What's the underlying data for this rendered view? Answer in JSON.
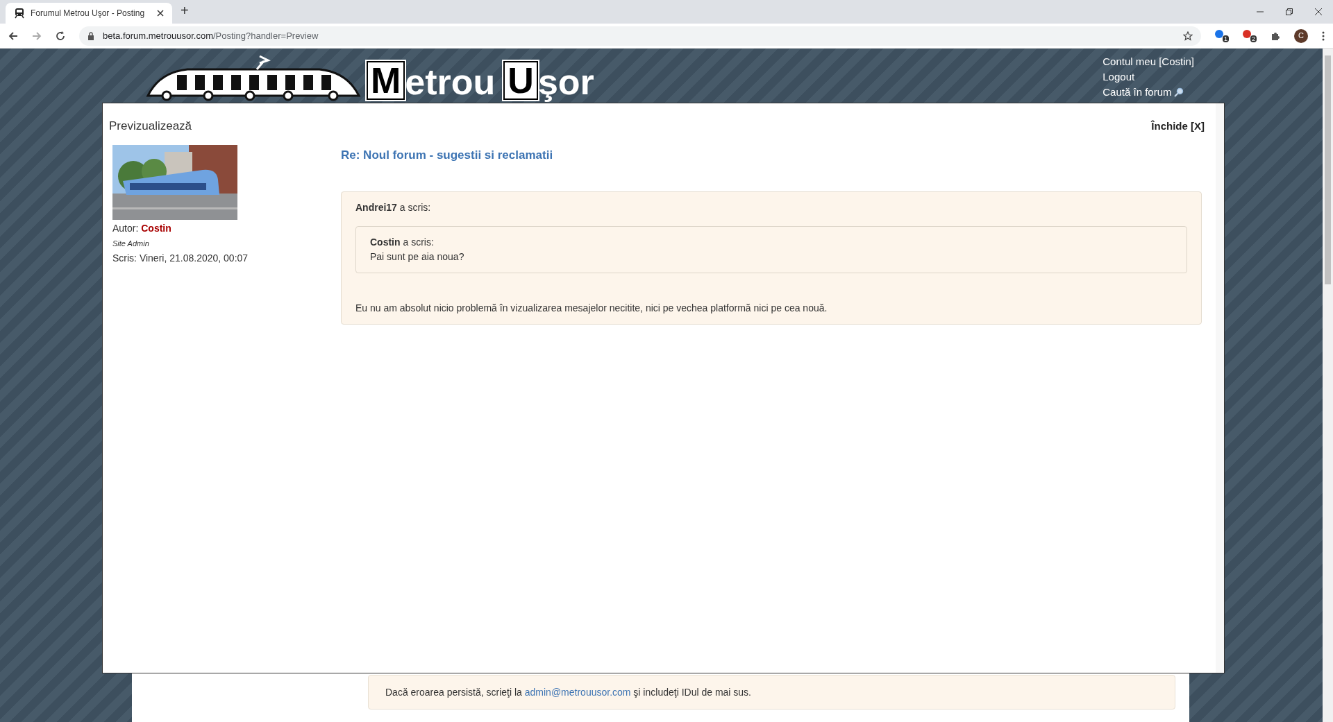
{
  "browser": {
    "tab": {
      "title": "Forumul Metrou Uşor - Posting",
      "selected": true
    },
    "new_tab": "+",
    "url_host": "beta.forum.metrouusor.com",
    "url_path": "/Posting?handler=Preview",
    "extensions": [
      {
        "badge": "1",
        "color": "#1a73e8"
      },
      {
        "badge": "2",
        "color": "#d93025"
      }
    ],
    "profile": "C"
  },
  "header": {
    "logo": [
      {
        "text": "M",
        "kind": "boxed"
      },
      {
        "text": "etrou",
        "kind": "plain"
      },
      {
        "text": "U",
        "kind": "boxed"
      },
      {
        "text": "şor",
        "kind": "plain"
      }
    ],
    "links": [
      {
        "label": "Contul meu [Costin]",
        "kind": "text"
      },
      {
        "label": "Logout",
        "kind": "text"
      },
      {
        "label": "Caută în forum",
        "kind": "search"
      }
    ]
  },
  "preview": {
    "title": "Previzualizează",
    "close": "Închide [X]",
    "author": {
      "label": "Autor:",
      "name": "Costin",
      "role": "Site Admin",
      "date": "Scris: Vineri, 21.08.2020, 00:07"
    },
    "subject": "Re: Noul forum - sugestii si reclamatii",
    "quote": {
      "author": "Andrei17",
      "verb": "a scris:",
      "nested": {
        "author": "Costin",
        "verb": "a scris:",
        "text": "Pai sunt pe aia noua?"
      }
    },
    "body": "Eu nu am absolut nicio problemă în vizualizarea mesajelor necitite, nici pe vechea platformă nici pe cea nouă."
  },
  "error_note": {
    "before": "Dacă eroarea persistă, scrieţi la",
    "link": "admin@metrouusor.com",
    "after": "şi includeţi IDul de mai sus."
  }
}
